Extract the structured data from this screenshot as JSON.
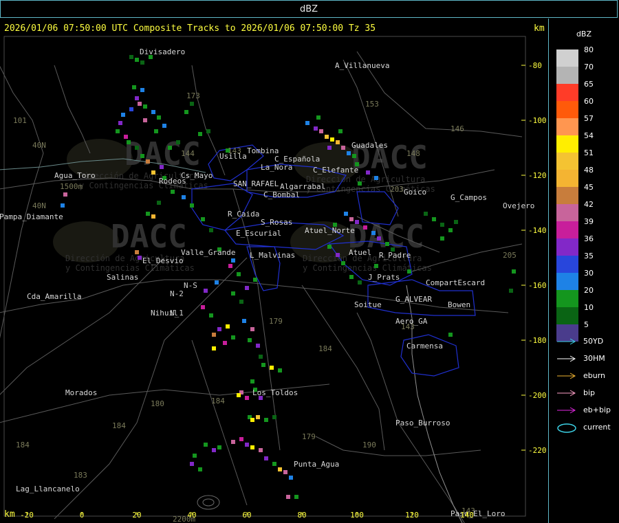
{
  "window": {
    "title": "dBZ"
  },
  "header": {
    "text": "2026/01/06 07:50:00 UTC Composite Tracks to 2026/01/06 07:50:00 Tz 35",
    "km_top": "km",
    "km_bottom": "km"
  },
  "axes": {
    "x_ticks": [
      {
        "label": "-20",
        "value": -20
      },
      {
        "label": "0",
        "value": 0
      },
      {
        "label": "20",
        "value": 20
      },
      {
        "label": "40",
        "value": 40
      },
      {
        "label": "60",
        "value": 60
      },
      {
        "label": "80",
        "value": 80
      },
      {
        "label": "100",
        "value": 100
      },
      {
        "label": "120",
        "value": 120
      },
      {
        "label": "140",
        "value": 140
      }
    ],
    "y_ticks": [
      {
        "label": "-80",
        "value": -80
      },
      {
        "label": "-100",
        "value": -100
      },
      {
        "label": "-120",
        "value": -120
      },
      {
        "label": "-140",
        "value": -140
      },
      {
        "label": "-160",
        "value": -160
      },
      {
        "label": "-180",
        "value": -180
      },
      {
        "label": "-200",
        "value": -200
      },
      {
        "label": "-220",
        "value": -220
      }
    ]
  },
  "places": [
    {
      "name": "Divisadero",
      "x": 21,
      "y": -76
    },
    {
      "name": "A_Villanueva",
      "x": 92,
      "y": -81
    },
    {
      "name": "Guadales",
      "x": 98,
      "y": -110
    },
    {
      "name": "Tombina",
      "x": 60,
      "y": -112
    },
    {
      "name": "Usilla",
      "x": 50,
      "y": -114
    },
    {
      "name": "La_Nora",
      "x": 65,
      "y": -118
    },
    {
      "name": "C_Española",
      "x": 70,
      "y": -115
    },
    {
      "name": "C_Elefante",
      "x": 84,
      "y": -119
    },
    {
      "name": "Agua_Toro",
      "x": -10,
      "y": -121
    },
    {
      "name": "Rodeos",
      "x": 28,
      "y": -123
    },
    {
      "name": "Cs_Mayo",
      "x": 36,
      "y": -121
    },
    {
      "name": "SAN_RAFAEL",
      "x": 55,
      "y": -124
    },
    {
      "name": "Algarrabal",
      "x": 72,
      "y": -125
    },
    {
      "name": "C_Bombal",
      "x": 66,
      "y": -128
    },
    {
      "name": "Goico",
      "x": 117,
      "y": -127
    },
    {
      "name": "G_Campos",
      "x": 134,
      "y": -129
    },
    {
      "name": "Ovejero",
      "x": 153,
      "y": -132
    },
    {
      "name": "Pampa_Diamante",
      "x": -30,
      "y": -136
    },
    {
      "name": "R_Caida",
      "x": 53,
      "y": -135
    },
    {
      "name": "S_Rosas",
      "x": 65,
      "y": -138
    },
    {
      "name": "E_Escurial",
      "x": 56,
      "y": -142
    },
    {
      "name": "Atuel_Norte",
      "x": 81,
      "y": -141
    },
    {
      "name": "Valle_Grande",
      "x": 36,
      "y": -149
    },
    {
      "name": "L_Malvinas",
      "x": 61,
      "y": -150
    },
    {
      "name": "Atuel",
      "x": 97,
      "y": -149
    },
    {
      "name": "R_Padre",
      "x": 108,
      "y": -150
    },
    {
      "name": "El_Desvio",
      "x": 22,
      "y": -152
    },
    {
      "name": "Salinas",
      "x": 9,
      "y": -158
    },
    {
      "name": "J_Prats",
      "x": 104,
      "y": -158
    },
    {
      "name": "CompartEscard",
      "x": 125,
      "y": -160
    },
    {
      "name": "Cda_Amarilla",
      "x": -20,
      "y": -165
    },
    {
      "name": "G_ALVEAR",
      "x": 114,
      "y": -166
    },
    {
      "name": "Soitue",
      "x": 99,
      "y": -168
    },
    {
      "name": "Bowen",
      "x": 133,
      "y": -168
    },
    {
      "name": "Nihuil",
      "x": 25,
      "y": -171
    },
    {
      "name": "Aero_GA",
      "x": 114,
      "y": -174
    },
    {
      "name": "Carmensa",
      "x": 118,
      "y": -183
    },
    {
      "name": "Los_Toldos",
      "x": 62,
      "y": -200
    },
    {
      "name": "Morados",
      "x": -6,
      "y": -200
    },
    {
      "name": "Paso_Burroso",
      "x": 114,
      "y": -211
    },
    {
      "name": "Punta_Agua",
      "x": 77,
      "y": -226
    },
    {
      "name": "Lag_Llancanelo",
      "x": -24,
      "y": -235
    },
    {
      "name": "Paso_El_Loro",
      "x": 134,
      "y": -244
    }
  ],
  "road_labels": [
    {
      "text": "153",
      "x": 103,
      "y": -95
    },
    {
      "text": "146",
      "x": 134,
      "y": -104
    },
    {
      "text": "143",
      "x": 53,
      "y": -112
    },
    {
      "text": "148",
      "x": 118,
      "y": -113
    },
    {
      "text": "203",
      "x": 112,
      "y": -126
    },
    {
      "text": "40N",
      "x": -18,
      "y": -110
    },
    {
      "text": "40N",
      "x": -18,
      "y": -132
    },
    {
      "text": "101",
      "x": -25,
      "y": -101
    },
    {
      "text": "173",
      "x": 38,
      "y": -92
    },
    {
      "text": "144",
      "x": 36,
      "y": -113
    },
    {
      "text": "179",
      "x": 68,
      "y": -174
    },
    {
      "text": "184",
      "x": 86,
      "y": -184
    },
    {
      "text": "180",
      "x": 25,
      "y": -204
    },
    {
      "text": "184",
      "x": 47,
      "y": -203
    },
    {
      "text": "184",
      "x": 11,
      "y": -212
    },
    {
      "text": "179",
      "x": 80,
      "y": -216
    },
    {
      "text": "190",
      "x": 102,
      "y": -219
    },
    {
      "text": "183",
      "x": -3,
      "y": -230
    },
    {
      "text": "184",
      "x": -24,
      "y": -219
    },
    {
      "text": "143",
      "x": 138,
      "y": -243
    },
    {
      "text": "205",
      "x": 153,
      "y": -150
    },
    {
      "text": "143",
      "x": 116,
      "y": -176
    }
  ],
  "watermark": {
    "brand": "DACC",
    "line1": "Dirección de Agricultura",
    "line2": "y Contingencias Climáticas",
    "elev1": "1500m",
    "elev2": "2200m",
    "label_ns": "N-S",
    "label_n2": "N-2",
    "label_n1": "N_1"
  },
  "legend": {
    "unit": "dBZ",
    "scale": [
      {
        "label": "80",
        "color": "#d0d0d0"
      },
      {
        "label": "70",
        "color": "#b4b4b4"
      },
      {
        "label": "65",
        "color": "#ff3c28"
      },
      {
        "label": "60",
        "color": "#ff5a0a"
      },
      {
        "label": "57",
        "color": "#ff9650"
      },
      {
        "label": "54",
        "color": "#ffee00"
      },
      {
        "label": "51",
        "color": "#f4c332"
      },
      {
        "label": "48",
        "color": "#f4b432"
      },
      {
        "label": "45",
        "color": "#c87d3c"
      },
      {
        "label": "42",
        "color": "#c8649b"
      },
      {
        "label": "39",
        "color": "#c81e9b"
      },
      {
        "label": "36",
        "color": "#8228c8"
      },
      {
        "label": "35",
        "color": "#2846dc"
      },
      {
        "label": "30",
        "color": "#1e82e6"
      },
      {
        "label": "20",
        "color": "#14961e"
      },
      {
        "label": "10",
        "color": "#0a6414"
      },
      {
        "label": "5",
        "color": "#4a3c8c"
      }
    ],
    "tracks": [
      {
        "label": "50YD",
        "color": "#3cd2e6"
      },
      {
        "label": "30HM",
        "color": "#ffffff"
      },
      {
        "label": "eburn",
        "color": "#f0b432"
      },
      {
        "label": "bip",
        "color": "#ffa0c8"
      },
      {
        "label": "eb+bip",
        "color": "#e628e6"
      }
    ],
    "current": {
      "label": "current",
      "color": "#3cd2e6"
    }
  },
  "colors": {
    "frame": "#5fb8c8",
    "header": "#ffff40",
    "roads": "#5a5a5a",
    "roadlabel": "#7a7a5a",
    "border": "#2030d0",
    "axis": "#ffff40"
  },
  "storm_cells": [
    {
      "x": 18,
      "y": -77,
      "dbz": 10
    },
    {
      "x": 20,
      "y": -78,
      "dbz": 20
    },
    {
      "x": 22,
      "y": -79,
      "dbz": 10
    },
    {
      "x": 25,
      "y": -77,
      "dbz": 20
    },
    {
      "x": 19,
      "y": -88,
      "dbz": 20
    },
    {
      "x": 22,
      "y": -89,
      "dbz": 30
    },
    {
      "x": 20,
      "y": -92,
      "dbz": 36
    },
    {
      "x": 21,
      "y": -94,
      "dbz": 42
    },
    {
      "x": 18,
      "y": -96,
      "dbz": 35
    },
    {
      "x": 23,
      "y": -95,
      "dbz": 20
    },
    {
      "x": 26,
      "y": -97,
      "dbz": 30
    },
    {
      "x": 28,
      "y": -99,
      "dbz": 20
    },
    {
      "x": 15,
      "y": -98,
      "dbz": 30
    },
    {
      "x": 14,
      "y": -101,
      "dbz": 36
    },
    {
      "x": 13,
      "y": -104,
      "dbz": 20
    },
    {
      "x": 16,
      "y": -106,
      "dbz": 39
    },
    {
      "x": 17,
      "y": -108,
      "dbz": 20
    },
    {
      "x": 23,
      "y": -100,
      "dbz": 42
    },
    {
      "x": 27,
      "y": -104,
      "dbz": 20
    },
    {
      "x": 30,
      "y": -102,
      "dbz": 30
    },
    {
      "x": 20,
      "y": -110,
      "dbz": 10
    },
    {
      "x": 22,
      "y": -113,
      "dbz": 20
    },
    {
      "x": 24,
      "y": -115,
      "dbz": 45
    },
    {
      "x": 29,
      "y": -117,
      "dbz": 36
    },
    {
      "x": 30,
      "y": -121,
      "dbz": 20
    },
    {
      "x": 26,
      "y": -119,
      "dbz": 51
    },
    {
      "x": 32,
      "y": -110,
      "dbz": 20
    },
    {
      "x": 35,
      "y": -108,
      "dbz": 10
    },
    {
      "x": 43,
      "y": -105,
      "dbz": 20
    },
    {
      "x": 46,
      "y": -104,
      "dbz": 10
    },
    {
      "x": 38,
      "y": -97,
      "dbz": 20
    },
    {
      "x": 40,
      "y": -94,
      "dbz": 10
    },
    {
      "x": 24,
      "y": -134,
      "dbz": 20
    },
    {
      "x": 26,
      "y": -135,
      "dbz": 48
    },
    {
      "x": 28,
      "y": -130,
      "dbz": 10
    },
    {
      "x": 33,
      "y": -126,
      "dbz": 20
    },
    {
      "x": 37,
      "y": -128,
      "dbz": 30
    },
    {
      "x": 40,
      "y": -131,
      "dbz": 20
    },
    {
      "x": 20,
      "y": -148,
      "dbz": 45
    },
    {
      "x": 21,
      "y": -150,
      "dbz": 36
    },
    {
      "x": 44,
      "y": -136,
      "dbz": 20
    },
    {
      "x": 47,
      "y": -140,
      "dbz": 10
    },
    {
      "x": 50,
      "y": -147,
      "dbz": 20
    },
    {
      "x": 55,
      "y": -151,
      "dbz": 30
    },
    {
      "x": 54,
      "y": -153,
      "dbz": 39
    },
    {
      "x": 57,
      "y": -156,
      "dbz": 20
    },
    {
      "x": 49,
      "y": -159,
      "dbz": 30
    },
    {
      "x": 45,
      "y": -162,
      "dbz": 36
    },
    {
      "x": 55,
      "y": -163,
      "dbz": 20
    },
    {
      "x": 58,
      "y": -166,
      "dbz": 10
    },
    {
      "x": 60,
      "y": -161,
      "dbz": 36
    },
    {
      "x": 63,
      "y": -158,
      "dbz": 20
    },
    {
      "x": 44,
      "y": -168,
      "dbz": 39
    },
    {
      "x": 47,
      "y": -171,
      "dbz": 20
    },
    {
      "x": 50,
      "y": -176,
      "dbz": 36
    },
    {
      "x": 48,
      "y": -178,
      "dbz": 45
    },
    {
      "x": 53,
      "y": -175,
      "dbz": 54
    },
    {
      "x": 55,
      "y": -179,
      "dbz": 20
    },
    {
      "x": 52,
      "y": -181,
      "dbz": 39
    },
    {
      "x": 48,
      "y": -183,
      "dbz": 54
    },
    {
      "x": 59,
      "y": -173,
      "dbz": 30
    },
    {
      "x": 62,
      "y": -176,
      "dbz": 42
    },
    {
      "x": 61,
      "y": -180,
      "dbz": 20
    },
    {
      "x": 64,
      "y": -182,
      "dbz": 36
    },
    {
      "x": 65,
      "y": -186,
      "dbz": 10
    },
    {
      "x": 66,
      "y": -189,
      "dbz": 20
    },
    {
      "x": 69,
      "y": -190,
      "dbz": 54
    },
    {
      "x": 72,
      "y": -191,
      "dbz": 20
    },
    {
      "x": 62,
      "y": -195,
      "dbz": 20
    },
    {
      "x": 58,
      "y": -199,
      "dbz": 42
    },
    {
      "x": 57,
      "y": -200,
      "dbz": 54
    },
    {
      "x": 60,
      "y": -201,
      "dbz": 39
    },
    {
      "x": 63,
      "y": -198,
      "dbz": 20
    },
    {
      "x": 65,
      "y": -201,
      "dbz": 36
    },
    {
      "x": 61,
      "y": -208,
      "dbz": 20
    },
    {
      "x": 62,
      "y": -209,
      "dbz": 54
    },
    {
      "x": 64,
      "y": -208,
      "dbz": 51
    },
    {
      "x": 67,
      "y": -209,
      "dbz": 20
    },
    {
      "x": 70,
      "y": -208,
      "dbz": 10
    },
    {
      "x": 45,
      "y": -218,
      "dbz": 20
    },
    {
      "x": 48,
      "y": -220,
      "dbz": 36
    },
    {
      "x": 50,
      "y": -219,
      "dbz": 20
    },
    {
      "x": 55,
      "y": -217,
      "dbz": 42
    },
    {
      "x": 58,
      "y": -216,
      "dbz": 39
    },
    {
      "x": 60,
      "y": -218,
      "dbz": 36
    },
    {
      "x": 62,
      "y": -219,
      "dbz": 54
    },
    {
      "x": 65,
      "y": -220,
      "dbz": 42
    },
    {
      "x": 67,
      "y": -223,
      "dbz": 36
    },
    {
      "x": 70,
      "y": -225,
      "dbz": 20
    },
    {
      "x": 72,
      "y": -227,
      "dbz": 51
    },
    {
      "x": 74,
      "y": -228,
      "dbz": 42
    },
    {
      "x": 76,
      "y": -230,
      "dbz": 30
    },
    {
      "x": 41,
      "y": -222,
      "dbz": 20
    },
    {
      "x": 40,
      "y": -225,
      "dbz": 36
    },
    {
      "x": 43,
      "y": -227,
      "dbz": 20
    },
    {
      "x": 75,
      "y": -237,
      "dbz": 42
    },
    {
      "x": 78,
      "y": -237,
      "dbz": 20
    },
    {
      "x": 82,
      "y": -101,
      "dbz": 30
    },
    {
      "x": 85,
      "y": -103,
      "dbz": 36
    },
    {
      "x": 87,
      "y": -104,
      "dbz": 42
    },
    {
      "x": 89,
      "y": -106,
      "dbz": 51
    },
    {
      "x": 91,
      "y": -107,
      "dbz": 54
    },
    {
      "x": 93,
      "y": -108,
      "dbz": 48
    },
    {
      "x": 95,
      "y": -110,
      "dbz": 42
    },
    {
      "x": 90,
      "y": -110,
      "dbz": 36
    },
    {
      "x": 97,
      "y": -112,
      "dbz": 30
    },
    {
      "x": 99,
      "y": -113,
      "dbz": 20
    },
    {
      "x": 86,
      "y": -99,
      "dbz": 20
    },
    {
      "x": 94,
      "y": -104,
      "dbz": 20
    },
    {
      "x": 100,
      "y": -116,
      "dbz": 20
    },
    {
      "x": 104,
      "y": -119,
      "dbz": 36
    },
    {
      "x": 107,
      "y": -121,
      "dbz": 30
    },
    {
      "x": 101,
      "y": -123,
      "dbz": 20
    },
    {
      "x": 96,
      "y": -134,
      "dbz": 30
    },
    {
      "x": 98,
      "y": -136,
      "dbz": 42
    },
    {
      "x": 100,
      "y": -137,
      "dbz": 36
    },
    {
      "x": 103,
      "y": -139,
      "dbz": 39
    },
    {
      "x": 106,
      "y": -141,
      "dbz": 30
    },
    {
      "x": 108,
      "y": -143,
      "dbz": 36
    },
    {
      "x": 111,
      "y": -145,
      "dbz": 20
    },
    {
      "x": 113,
      "y": -147,
      "dbz": 10
    },
    {
      "x": 92,
      "y": -138,
      "dbz": 20
    },
    {
      "x": 90,
      "y": -146,
      "dbz": 20
    },
    {
      "x": 93,
      "y": -149,
      "dbz": 36
    },
    {
      "x": 95,
      "y": -152,
      "dbz": 20
    },
    {
      "x": 98,
      "y": -157,
      "dbz": 20
    },
    {
      "x": 101,
      "y": -159,
      "dbz": 10
    },
    {
      "x": 107,
      "y": -153,
      "dbz": 20
    },
    {
      "x": 119,
      "y": -155,
      "dbz": 20
    },
    {
      "x": 128,
      "y": -136,
      "dbz": 20
    },
    {
      "x": 131,
      "y": -138,
      "dbz": 10
    },
    {
      "x": 134,
      "y": -140,
      "dbz": 20
    },
    {
      "x": 136,
      "y": -137,
      "dbz": 10
    },
    {
      "x": 131,
      "y": -143,
      "dbz": 20
    },
    {
      "x": 125,
      "y": -134,
      "dbz": 10
    },
    {
      "x": 134,
      "y": -178,
      "dbz": 20
    },
    {
      "x": 157,
      "y": -155,
      "dbz": 20
    },
    {
      "x": 156,
      "y": -162,
      "dbz": 10
    },
    {
      "x": -6,
      "y": -127,
      "dbz": 42
    },
    {
      "x": -7,
      "y": -131,
      "dbz": 30
    },
    {
      "x": 53,
      "y": -111,
      "dbz": 20
    }
  ]
}
